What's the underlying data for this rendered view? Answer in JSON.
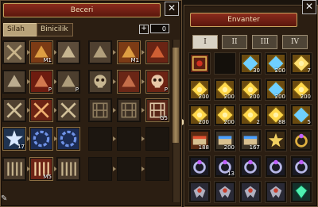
{
  "skill_window": {
    "title": "Beceri",
    "tabs": [
      "Silah",
      "Binicilik"
    ],
    "plus_label": "+",
    "points": "0",
    "skills": [
      {
        "row": 0,
        "col": 0,
        "art": "crossed-blades",
        "frame": false,
        "num": ""
      },
      {
        "row": 0,
        "col": 1,
        "art": "bird-gold",
        "frame": true,
        "num": "M1"
      },
      {
        "row": 0,
        "col": 2,
        "art": "eagle",
        "frame": false,
        "num": ""
      },
      {
        "row": 0,
        "col": 3,
        "art": "crescent",
        "frame": false,
        "num": ""
      },
      {
        "row": 0,
        "col": 4,
        "art": "bird-gold",
        "frame": true,
        "num": "M1"
      },
      {
        "row": 0,
        "col": 5,
        "art": "claw",
        "frame": true,
        "num": ""
      },
      {
        "row": 1,
        "col": 0,
        "art": "sword",
        "frame": false,
        "num": ""
      },
      {
        "row": 1,
        "col": 1,
        "art": "strike-red",
        "frame": true,
        "num": "P"
      },
      {
        "row": 1,
        "col": 2,
        "art": "strike",
        "frame": false,
        "num": "P"
      },
      {
        "row": 1,
        "col": 3,
        "art": "skull",
        "frame": false,
        "num": ""
      },
      {
        "row": 1,
        "col": 4,
        "art": "flame-mark",
        "frame": true,
        "num": ""
      },
      {
        "row": 1,
        "col": 5,
        "art": "skull-red",
        "frame": true,
        "num": "P"
      },
      {
        "row": 2,
        "col": 0,
        "art": "axes",
        "frame": false,
        "num": ""
      },
      {
        "row": 2,
        "col": 1,
        "art": "axes-red",
        "frame": true,
        "num": ""
      },
      {
        "row": 2,
        "col": 2,
        "art": "axes",
        "frame": false,
        "num": ""
      },
      {
        "row": 2,
        "col": 3,
        "art": "rune-grid",
        "frame": false,
        "num": ""
      },
      {
        "row": 2,
        "col": 4,
        "art": "rune-grid",
        "frame": false,
        "num": ""
      },
      {
        "row": 2,
        "col": 5,
        "art": "rune-grid-red",
        "frame": true,
        "num": "G5"
      },
      {
        "row": 3,
        "col": 0,
        "art": "star-blue",
        "frame": true,
        "num": "17"
      },
      {
        "row": 3,
        "col": 1,
        "art": "spiral-blue",
        "frame": true,
        "num": ""
      },
      {
        "row": 3,
        "col": 2,
        "art": "spiral-blue",
        "frame": true,
        "num": ""
      },
      {
        "row": 3,
        "col": 3,
        "art": "empty",
        "frame": false,
        "num": ""
      },
      {
        "row": 3,
        "col": 4,
        "art": "empty",
        "frame": false,
        "num": ""
      },
      {
        "row": 3,
        "col": 5,
        "art": "empty",
        "frame": false,
        "num": ""
      },
      {
        "row": 4,
        "col": 0,
        "art": "pillars",
        "frame": false,
        "num": ""
      },
      {
        "row": 4,
        "col": 1,
        "art": "pillars-red",
        "frame": true,
        "num": "M5"
      },
      {
        "row": 4,
        "col": 2,
        "art": "pillars",
        "frame": false,
        "num": ""
      },
      {
        "row": 4,
        "col": 3,
        "art": "empty",
        "frame": false,
        "num": ""
      },
      {
        "row": 4,
        "col": 4,
        "art": "empty",
        "frame": false,
        "num": ""
      },
      {
        "row": 4,
        "col": 5,
        "art": "empty",
        "frame": false,
        "num": ""
      }
    ]
  },
  "inventory_window": {
    "title": "Envanter",
    "tabs": [
      "I",
      "II",
      "III",
      "IV"
    ],
    "items": [
      {
        "row": 0,
        "col": 0,
        "art": "ornate-red",
        "num": ""
      },
      {
        "row": 0,
        "col": 1,
        "art": "empty",
        "num": ""
      },
      {
        "row": 0,
        "col": 2,
        "art": "gold-blue-orb",
        "num": "30"
      },
      {
        "row": 0,
        "col": 3,
        "art": "gold-blue-orb",
        "num": "200"
      },
      {
        "row": 0,
        "col": 4,
        "art": "gold-orb",
        "num": "7"
      },
      {
        "row": 1,
        "col": 0,
        "art": "gold-gem",
        "num": "200"
      },
      {
        "row": 1,
        "col": 1,
        "art": "gold-gem",
        "num": "200"
      },
      {
        "row": 1,
        "col": 2,
        "art": "gold-gem",
        "num": "200"
      },
      {
        "row": 1,
        "col": 3,
        "art": "gold-blue-orb",
        "num": "200"
      },
      {
        "row": 1,
        "col": 4,
        "art": "gold-gem",
        "num": "200"
      },
      {
        "row": 2,
        "col": 0,
        "art": "gold-gem",
        "num": "200"
      },
      {
        "row": 2,
        "col": 1,
        "art": "gold-gem",
        "num": "200"
      },
      {
        "row": 2,
        "col": 2,
        "art": "gold-gem",
        "num": "2"
      },
      {
        "row": 2,
        "col": 3,
        "art": "gold-gem",
        "num": "88"
      },
      {
        "row": 2,
        "col": 4,
        "art": "gold-blue-orb",
        "num": "5"
      },
      {
        "row": 3,
        "col": 0,
        "art": "scroll-red",
        "num": "188"
      },
      {
        "row": 3,
        "col": 1,
        "art": "scroll-blue",
        "num": "200"
      },
      {
        "row": 3,
        "col": 2,
        "art": "scroll-blue",
        "num": "167"
      },
      {
        "row": 3,
        "col": 3,
        "art": "star-gold",
        "num": ""
      },
      {
        "row": 3,
        "col": 4,
        "art": "ring-gold",
        "num": ""
      },
      {
        "row": 4,
        "col": 0,
        "art": "ring-silver",
        "num": ""
      },
      {
        "row": 4,
        "col": 1,
        "art": "ring-silver",
        "num": "13"
      },
      {
        "row": 4,
        "col": 2,
        "art": "ring-silver",
        "num": ""
      },
      {
        "row": 4,
        "col": 3,
        "art": "ring-silver",
        "num": ""
      },
      {
        "row": 4,
        "col": 4,
        "art": "ring-silver",
        "num": ""
      },
      {
        "row": 5,
        "col": 0,
        "art": "armor-wing",
        "num": ""
      },
      {
        "row": 5,
        "col": 1,
        "art": "armor-wing",
        "num": ""
      },
      {
        "row": 5,
        "col": 2,
        "art": "armor-wing",
        "num": ""
      },
      {
        "row": 5,
        "col": 3,
        "art": "armor-wing",
        "num": ""
      },
      {
        "row": 5,
        "col": 4,
        "art": "gem-green",
        "num": ""
      }
    ]
  },
  "colors": {
    "title_bar": "#7a2216",
    "panel_bg": "#2b1e12",
    "tab_active": "#d8d2c4"
  }
}
